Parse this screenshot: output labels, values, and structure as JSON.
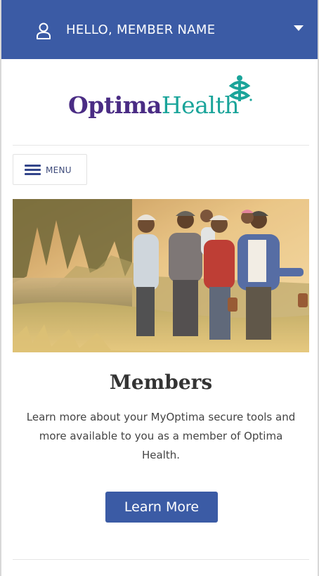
{
  "header": {
    "greeting": "HELLO, MEMBER NAME",
    "user_icon": "user-icon",
    "dropdown_icon": "caret-down-icon",
    "background": "#3b5ba5"
  },
  "logo": {
    "part1": "Optima",
    "part2": "Health",
    "part1_color": "#4a2c84",
    "part2_color": "#1aa49a"
  },
  "nav": {
    "menu_label": "MENU",
    "menu_icon": "hamburger-icon"
  },
  "members": {
    "title": "Members",
    "description": "Learn more about your MyOptima secure tools and more available to you as a member of Optima Health.",
    "button_label": "Learn More"
  }
}
